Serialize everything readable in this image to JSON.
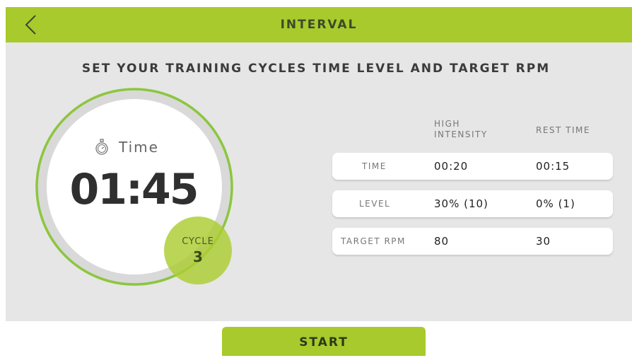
{
  "header": {
    "title": "INTERVAL",
    "back_icon": "chevron-left-icon"
  },
  "subtitle": "SET YOUR TRAINING CYCLES TIME LEVEL AND TARGET RPM",
  "timer": {
    "label": "Time",
    "icon": "stopwatch-icon",
    "value": "01:45",
    "cycle_label": "CYCLE",
    "cycle_number": "3"
  },
  "table": {
    "columns": [
      "HIGH\nINTENSITY",
      "REST TIME"
    ],
    "rows": [
      {
        "label": "TIME",
        "high": "00:20",
        "rest": "00:15"
      },
      {
        "label": "LEVEL",
        "high": "30% (10)",
        "rest": "0% (1)"
      },
      {
        "label": "TARGET RPM",
        "high": "80",
        "rest": "30"
      }
    ]
  },
  "start_label": "START",
  "colors": {
    "accent": "#a8ca2c",
    "panel_background": "#e6e6e6",
    "ring_track": "#d9d9d9"
  }
}
